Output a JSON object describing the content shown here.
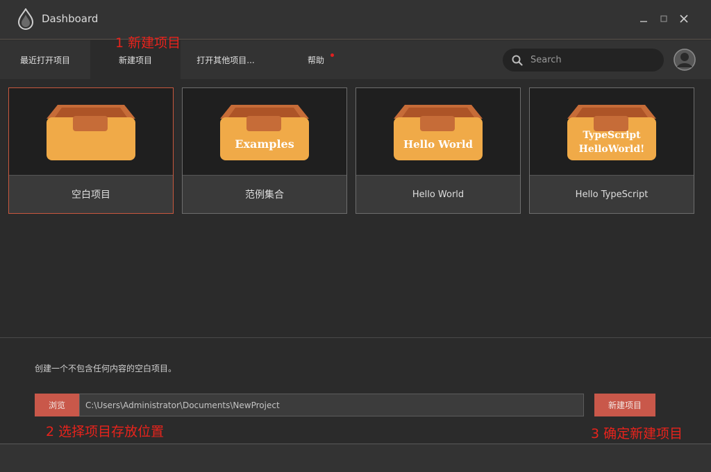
{
  "app": {
    "title": "Dashboard"
  },
  "nav": {
    "tabs": [
      {
        "label": "最近打开项目"
      },
      {
        "label": "新建项目"
      },
      {
        "label": "打开其他项目..."
      },
      {
        "label": "帮助"
      }
    ],
    "active_tab": 1,
    "search": {
      "placeholder": "Search",
      "value": ""
    }
  },
  "cards": [
    {
      "label": "空白项目",
      "box_text": "",
      "selected": true
    },
    {
      "label": "范例集合",
      "box_text": "Examples",
      "selected": false
    },
    {
      "label": "Hello World",
      "box_text": "Hello World",
      "selected": false
    },
    {
      "label": "Hello TypeScript",
      "box_text_line1": "TypeScript",
      "box_text_line2": "HelloWorld!",
      "selected": false
    }
  ],
  "bottom": {
    "description": "创建一个不包含任何内容的空白项目。",
    "browse_label": "浏览",
    "path_value": "C:\\Users\\Administrator\\Documents\\NewProject",
    "create_label": "新建项目"
  },
  "annotations": {
    "step1": "1 新建项目",
    "step2": "2 选择项目存放位置",
    "step3": "3 确定新建项目"
  },
  "colors": {
    "accent": "#c9584a",
    "selected_border": "#c9583e",
    "box_body": "#f0aa48",
    "box_lid": "#c66c38",
    "annotation": "#e8231c",
    "notification_dot": "#e02020"
  },
  "icons": {
    "logo": "flame-logo-icon",
    "search": "search-icon",
    "avatar": "user-avatar-icon",
    "minimize": "minimize-icon",
    "maximize": "maximize-icon",
    "close": "close-icon"
  }
}
